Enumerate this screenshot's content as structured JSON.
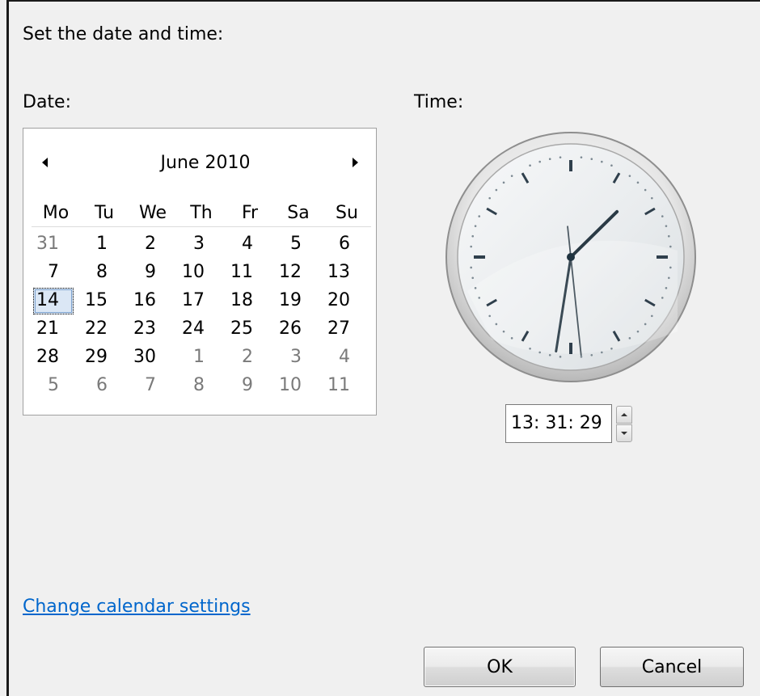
{
  "dialog": {
    "heading": "Set the date and time:",
    "date_label": "Date:",
    "time_label": "Time:"
  },
  "calendar": {
    "month_title": "June 2010",
    "prev_icon": "triangle-left-icon",
    "next_icon": "triangle-right-icon",
    "weekdays": [
      "Mo",
      "Tu",
      "We",
      "Th",
      "Fr",
      "Sa",
      "Su"
    ],
    "weeks": [
      [
        "31",
        "1",
        "2",
        "3",
        "4",
        "5",
        "6"
      ],
      [
        "7",
        "8",
        "9",
        "10",
        "11",
        "12",
        "13"
      ],
      [
        "14",
        "15",
        "16",
        "17",
        "18",
        "19",
        "20"
      ],
      [
        "21",
        "22",
        "23",
        "24",
        "25",
        "26",
        "27"
      ],
      [
        "28",
        "29",
        "30",
        "1",
        "2",
        "3",
        "4"
      ],
      [
        "5",
        "6",
        "7",
        "8",
        "9",
        "10",
        "11"
      ]
    ],
    "other_month_color": "#7a7a7a",
    "selected_day": "14"
  },
  "clock": {
    "hours": 13,
    "minutes": 31,
    "seconds": 29
  },
  "time_field": {
    "value": "13: 31: 29",
    "spin_up_icon": "spin-up-icon",
    "spin_down_icon": "spin-down-icon"
  },
  "links": {
    "calendar_settings": "Change calendar settings",
    "link_color": "#0066cc"
  },
  "buttons": {
    "ok": "OK",
    "cancel": "Cancel"
  }
}
